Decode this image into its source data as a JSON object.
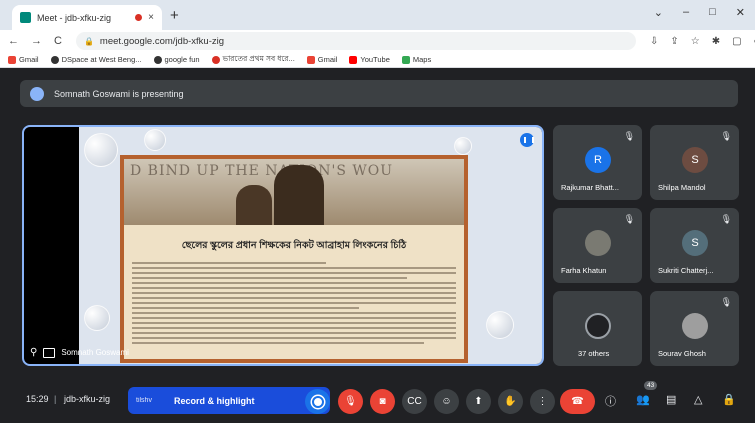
{
  "browser": {
    "tab_title": "Meet - jdb-xfku-zig",
    "tab_close": "×",
    "new_tab": "+",
    "window_controls": [
      "⌄",
      "–",
      "□",
      "✕"
    ],
    "url": "meet.google.com/jdb-xfku-zig",
    "nav": [
      "←",
      "→",
      "C"
    ],
    "addr_icons": [
      "⇩",
      "⇪",
      "☆",
      "✱",
      "▢",
      "●",
      "⋮"
    ],
    "bookmarks": [
      {
        "label": "Gmail",
        "color": "#ea4335"
      },
      {
        "label": "DSpace at West Beng...",
        "color": "#333333"
      },
      {
        "label": "google fun",
        "color": "#333333"
      },
      {
        "label": "ভারতের প্রথম সব ধরে...",
        "color": "#d93025"
      },
      {
        "label": "Gmail",
        "color": "#ea4335"
      },
      {
        "label": "YouTube",
        "color": "#ff0000"
      },
      {
        "label": "Maps",
        "color": "#34a853"
      }
    ]
  },
  "meet": {
    "presenting_text": "Somnath Goswami is presenting",
    "slide": {
      "engraving": "D BIND UP THE NATION'S WOU",
      "title": "ছেলের স্কুলের প্রধান শিক্ষকের নিকট আব্রাহাম লিংকনের চিঠি"
    },
    "stage_name": "Somnath Goswami",
    "tiles": [
      {
        "name": "Rajkumar Bhatt...",
        "initial": "R",
        "color": "#1a73e8"
      },
      {
        "name": "Shilpa Mandol",
        "initial": "S",
        "color": "#6d4c41"
      },
      {
        "name": "Farha Khatun",
        "initial": "",
        "color": "#7a7a72"
      },
      {
        "name": "Sukriti Chatterj...",
        "initial": "S",
        "color": "#546e7a"
      },
      {
        "name": "37 others",
        "initial": "",
        "color": "#3c4043"
      },
      {
        "name": "Sourav Ghosh",
        "initial": "",
        "color": "#9e9e9e"
      }
    ],
    "bottom": {
      "time": "15:29",
      "separator": "|",
      "meeting_code": "jdb-xfku-zig",
      "record_left": "tilshv",
      "record_label": "Record & highlight",
      "participants_count": "43"
    }
  }
}
